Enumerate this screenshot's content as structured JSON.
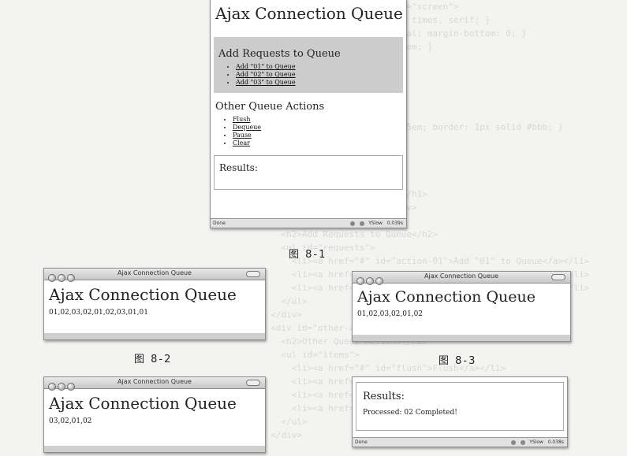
{
  "browser_main": {
    "app_title": "Ajax Connection Queue",
    "add_section_heading": "Add Requests to Queue",
    "add_links": [
      "Add \"01\" to Queue",
      "Add \"02\" to Queue",
      "Add \"03\" to Queue"
    ],
    "other_heading": "Other Queue Actions",
    "action_links": [
      "Flush",
      "Dequeue",
      "Pause",
      "Clear"
    ],
    "results_heading": "Results:",
    "status_left": "Done",
    "status_yslow": "YSlow",
    "status_time": "0.039s"
  },
  "captions": {
    "fig1": "图  8-1",
    "fig2": "图  8-2",
    "fig3": "图  8-3"
  },
  "win_fig2": {
    "window_title": "Ajax Connection Queue",
    "app_title": "Ajax Connection Queue",
    "queue": "01,02,03,02,01,02,03,01,01"
  },
  "win_fig3": {
    "window_title": "Ajax Connection Queue",
    "app_title": "Ajax Connection Queue",
    "queue": "01,02,03,02,01,02"
  },
  "win_fig4": {
    "window_title": "Ajax Connection Queue",
    "app_title": "Ajax Connection Queue",
    "queue": "03,02,01,02"
  },
  "win_results": {
    "results_heading": "Results:",
    "processed_label": "Processed:",
    "processed_value": "02",
    "completed": "Completed!",
    "status_left": "Done",
    "status_yslow": "YSlow",
    "status_time": "0.038s"
  }
}
